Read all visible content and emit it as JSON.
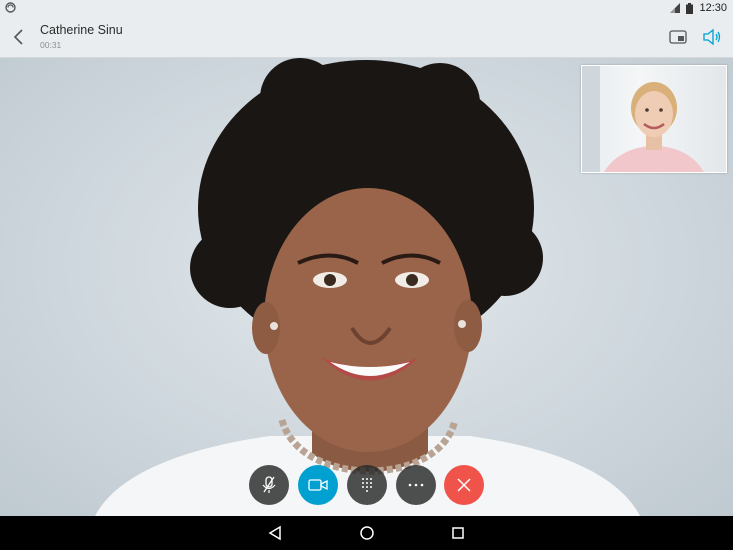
{
  "status_bar": {
    "time": "12:30",
    "icons": [
      "sync-icon",
      "signal-icon",
      "battery-icon"
    ]
  },
  "header": {
    "caller_name": "Catherine Sinu",
    "call_timer": "00:31",
    "icons": [
      "back-arrow-icon",
      "picture-in-picture-icon",
      "speaker-icon"
    ],
    "accent_color": "#00a0d1"
  },
  "controls": {
    "buttons": [
      {
        "name": "mute-button",
        "icon": "microphone-muted-icon",
        "color": "#2a2a2a"
      },
      {
        "name": "video-button",
        "icon": "video-camera-icon",
        "color": "#00a0d1"
      },
      {
        "name": "dialpad-button",
        "icon": "dialpad-icon",
        "color": "#2a2a2a"
      },
      {
        "name": "more-button",
        "icon": "more-dots-icon",
        "color": "#2a2a2a"
      },
      {
        "name": "end-call-button",
        "icon": "close-icon",
        "color": "#f0534a"
      }
    ]
  },
  "nav_bar": {
    "icons": [
      "nav-back-icon",
      "nav-home-icon",
      "nav-recents-icon"
    ]
  }
}
